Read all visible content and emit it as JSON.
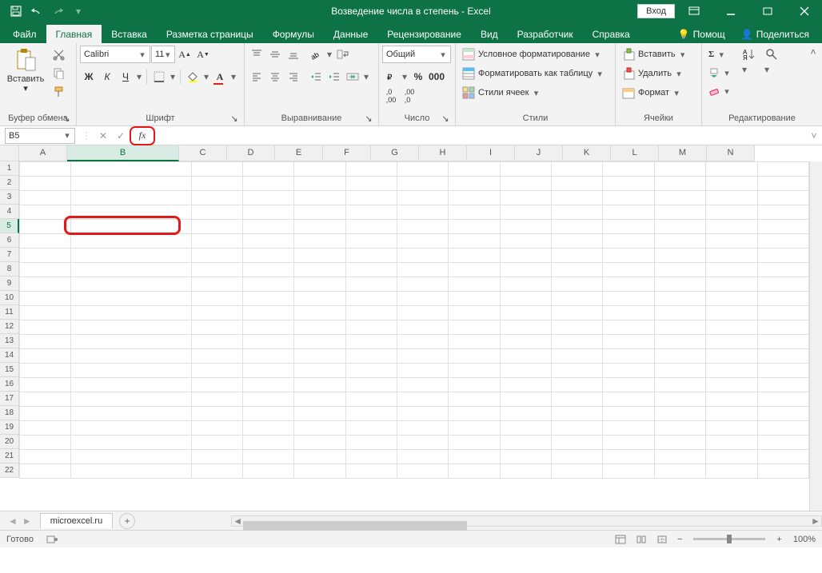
{
  "titlebar": {
    "title": "Возведение числа в степень - Excel",
    "login": "Вход"
  },
  "tabs": {
    "file": "Файл",
    "home": "Главная",
    "insert": "Вставка",
    "layout": "Разметка страницы",
    "formulas": "Формулы",
    "data": "Данные",
    "review": "Рецензирование",
    "view": "Вид",
    "developer": "Разработчик",
    "help": "Справка",
    "tellme": "Помощ",
    "share": "Поделиться"
  },
  "ribbon": {
    "clipboard": {
      "label": "Буфер обмена",
      "paste": "Вставить"
    },
    "font": {
      "label": "Шрифт",
      "name": "Calibri",
      "size": "11",
      "bold": "Ж",
      "italic": "К",
      "underline": "Ч"
    },
    "alignment": {
      "label": "Выравнивание"
    },
    "number": {
      "label": "Число",
      "format": "Общий"
    },
    "styles": {
      "label": "Стили",
      "cond": "Условное форматирование",
      "table": "Форматировать как таблицу",
      "cell": "Стили ячеек"
    },
    "cells": {
      "label": "Ячейки",
      "insert": "Вставить",
      "delete": "Удалить",
      "format": "Формат"
    },
    "editing": {
      "label": "Редактирование"
    }
  },
  "formulabar": {
    "namebox": "B5"
  },
  "columns": [
    "A",
    "B",
    "C",
    "D",
    "E",
    "F",
    "G",
    "H",
    "I",
    "J",
    "K",
    "L",
    "M",
    "N"
  ],
  "active_column": "B",
  "active_row": 5,
  "total_rows": 22,
  "sheet": {
    "name": "microexcel.ru"
  },
  "status": {
    "ready": "Готово",
    "zoom": "100%"
  }
}
